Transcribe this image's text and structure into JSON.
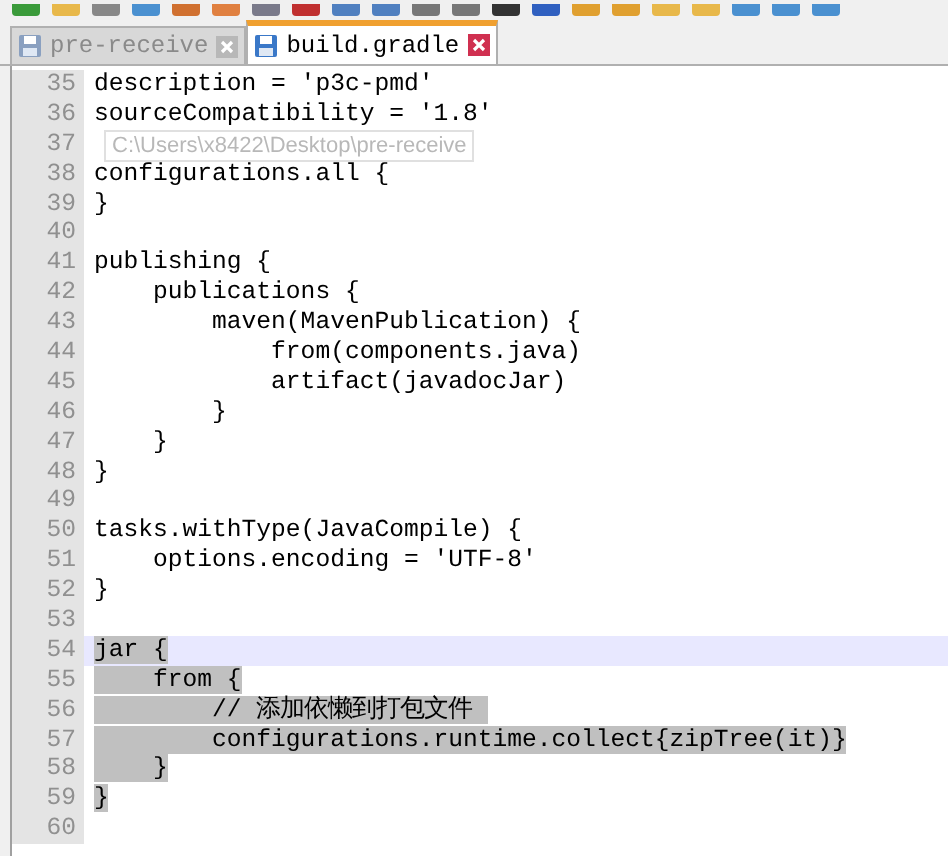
{
  "tabs": [
    {
      "label": "pre-receive",
      "selected": false
    },
    {
      "label": "build.gradle",
      "selected": true
    }
  ],
  "tooltip": "C:\\Users\\x8422\\Desktop\\pre-receive",
  "editor": {
    "lines": [
      {
        "number": "35",
        "text": "description = 'p3c-pmd'",
        "selected": false,
        "current": false
      },
      {
        "number": "36",
        "text": "sourceCompatibility = '1.8'",
        "selected": false,
        "current": false
      },
      {
        "number": "37",
        "current": false
      },
      {
        "number": "38",
        "text": "configurations.all {",
        "selected": false,
        "current": false
      },
      {
        "number": "39",
        "text": "}",
        "selected": false,
        "current": false
      },
      {
        "number": "40",
        "current": false
      },
      {
        "number": "41",
        "text": "publishing {",
        "selected": false,
        "current": false
      },
      {
        "number": "42",
        "text": "    publications {",
        "selected": false,
        "current": false
      },
      {
        "number": "43",
        "text": "        maven(MavenPublication) {",
        "selected": false,
        "current": false
      },
      {
        "number": "44",
        "text": "            from(components.java)",
        "selected": false,
        "current": false
      },
      {
        "number": "45",
        "text": "            artifact(javadocJar)",
        "selected": false,
        "current": false
      },
      {
        "number": "46",
        "text": "        }",
        "selected": false,
        "current": false
      },
      {
        "number": "47",
        "text": "    }",
        "selected": false,
        "current": false
      },
      {
        "number": "48",
        "text": "}",
        "selected": false,
        "current": false
      },
      {
        "number": "49",
        "current": false
      },
      {
        "number": "50",
        "text": "tasks.withType(JavaCompile) {",
        "selected": false,
        "current": false
      },
      {
        "number": "51",
        "text": "    options.encoding = 'UTF-8'",
        "selected": false,
        "current": false
      },
      {
        "number": "52",
        "text": "}",
        "selected": false,
        "current": false
      },
      {
        "number": "53",
        "current": false
      },
      {
        "number": "54",
        "text": "jar {",
        "selected": true,
        "current": true
      },
      {
        "number": "55",
        "text": "    from {",
        "selected": true,
        "current": false
      },
      {
        "number": "56",
        "text": "        // 添加依懒到打包文件 ",
        "selected": true,
        "current": false
      },
      {
        "number": "57",
        "text": "        configurations.runtime.collect{zipTree(it)}",
        "selected": true,
        "current": false
      },
      {
        "number": "58",
        "text": "    }",
        "selected": true,
        "current": false
      },
      {
        "number": "59",
        "text": "}",
        "selected": true,
        "current": false
      },
      {
        "number": "60",
        "current": false
      }
    ]
  }
}
